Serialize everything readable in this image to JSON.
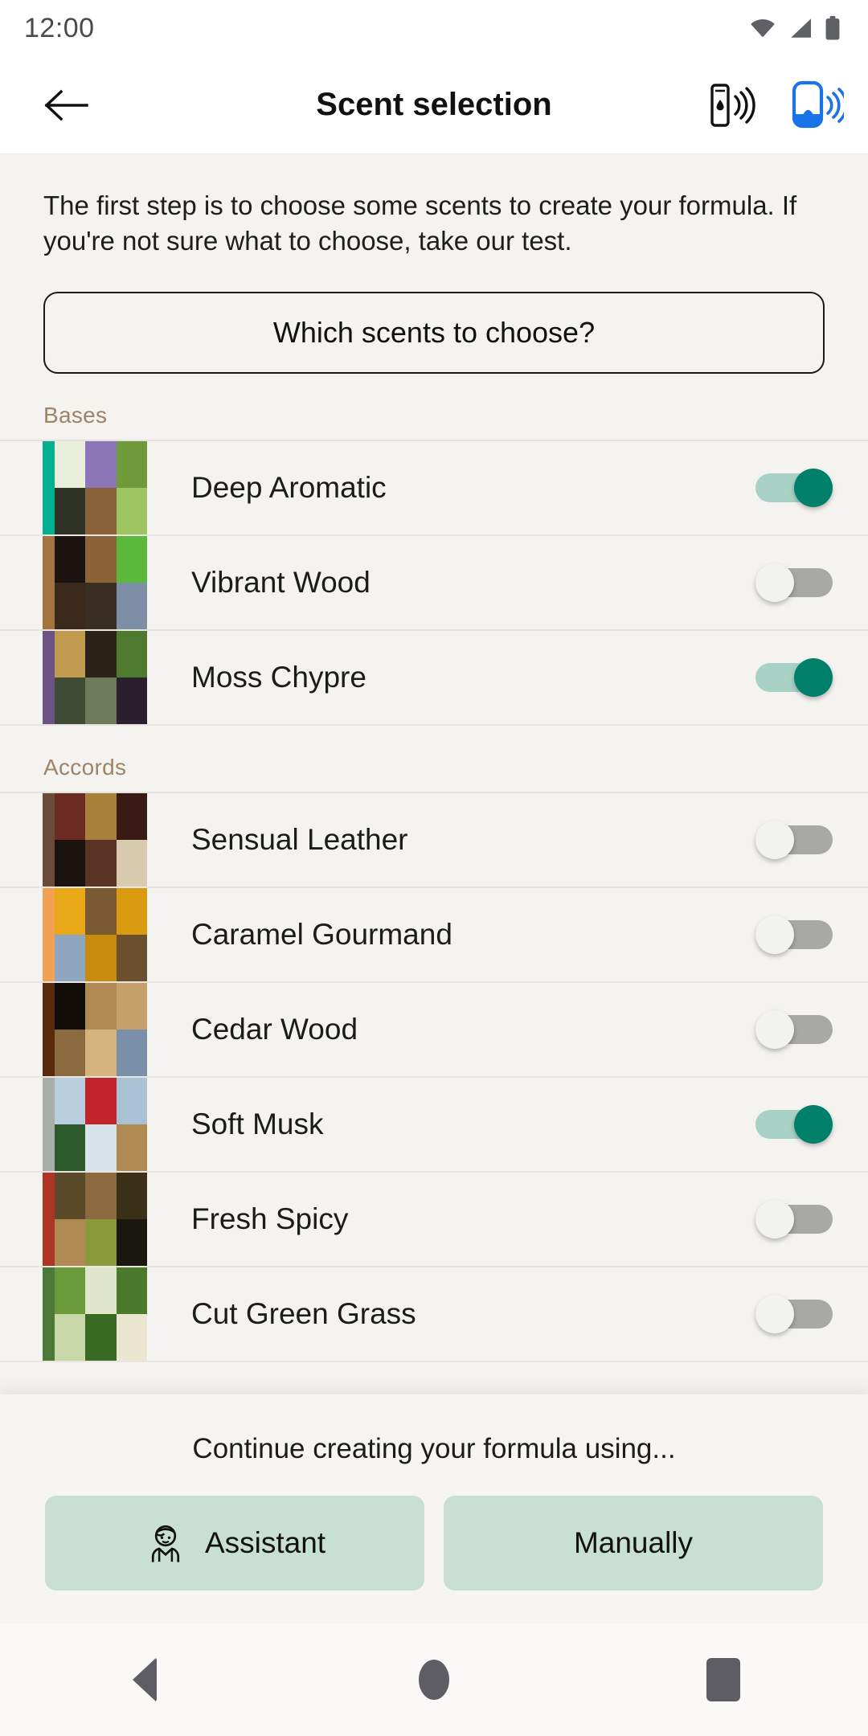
{
  "status_bar": {
    "time": "12:00",
    "icons": [
      "wifi-icon",
      "cellular-signal-icon",
      "battery-icon"
    ]
  },
  "app_bar": {
    "title": "Scent selection",
    "back_icon": "back-arrow-icon",
    "actions": [
      {
        "name": "scent-pen-nfc-icon",
        "color": "#111111"
      },
      {
        "name": "cartridge-nfc-icon",
        "color": "#1A73E8"
      }
    ]
  },
  "intro": {
    "text": "The first step is to choose some scents to create your formula. If you're not sure what to choose, take our test."
  },
  "choose_button": {
    "label": "Which scents to choose?"
  },
  "sections": [
    {
      "title": "Bases",
      "items": [
        {
          "name": "Deep Aromatic",
          "accent": "#00B08F",
          "enabled": true,
          "thumb": [
            "#e8f0dc",
            "#8d76b8",
            "#6f9a3a",
            "#2e3326",
            "#8a6239",
            "#9dc562"
          ]
        },
        {
          "name": "Vibrant Wood",
          "accent": "#A5733E",
          "enabled": false,
          "thumb": [
            "#1b1410",
            "#8c6239",
            "#5ab83a",
            "#3b2a1c",
            "#3a2d22",
            "#7d8fa6"
          ]
        },
        {
          "name": "Moss Chypre",
          "accent": "#6D5384",
          "enabled": true,
          "thumb": [
            "#c09a4e",
            "#2c2218",
            "#4e7a2e",
            "#3e4a33",
            "#6f7a5a",
            "#2a1f2c"
          ]
        }
      ]
    },
    {
      "title": "Accords",
      "items": [
        {
          "name": "Sensual Leather",
          "accent": "#6B4A38",
          "enabled": false,
          "thumb": [
            "#6b2a22",
            "#a8803a",
            "#3a1a14",
            "#1a120e",
            "#5a3324",
            "#d8cbb0"
          ]
        },
        {
          "name": "Caramel Gourmand",
          "accent": "#F2A054",
          "enabled": false,
          "thumb": [
            "#e8a817",
            "#7a5a30",
            "#d99a10",
            "#8fa6c0",
            "#c98b0c",
            "#6b5030"
          ]
        },
        {
          "name": "Cedar Wood",
          "accent": "#5A2A0C",
          "enabled": false,
          "thumb": [
            "#120d08",
            "#b08a52",
            "#c6a06a",
            "#8a6a3e",
            "#d6b480",
            "#7a90aa"
          ]
        },
        {
          "name": "Soft Musk",
          "accent": "#A9AEA8",
          "enabled": true,
          "thumb": [
            "#b9cfdd",
            "#c1242a",
            "#a8c2d4",
            "#2d5a2c",
            "#d8e4ea",
            "#b08a52"
          ]
        },
        {
          "name": "Fresh Spicy",
          "accent": "#B03423",
          "enabled": false,
          "thumb": [
            "#5a4a2a",
            "#8a6a3e",
            "#3a3018",
            "#b08a52",
            "#8a9a3a",
            "#1a1610"
          ]
        },
        {
          "name": "Cut Green Grass",
          "accent": "#4A7A36",
          "enabled": false,
          "thumb": [
            "#6a9a3a",
            "#dfe6cc",
            "#4a7a2a",
            "#c8d8a8",
            "#3a6a22",
            "#eae6d0"
          ]
        }
      ]
    }
  ],
  "bottom_sheet": {
    "caption": "Continue creating your formula using...",
    "buttons": [
      {
        "label": "Assistant",
        "icon": "assistant-person-icon"
      },
      {
        "label": "Manually",
        "icon": null
      }
    ]
  },
  "nav_bar": {
    "back": "nav-back-icon",
    "home": "nav-home-icon",
    "recents": "nav-recents-icon"
  }
}
